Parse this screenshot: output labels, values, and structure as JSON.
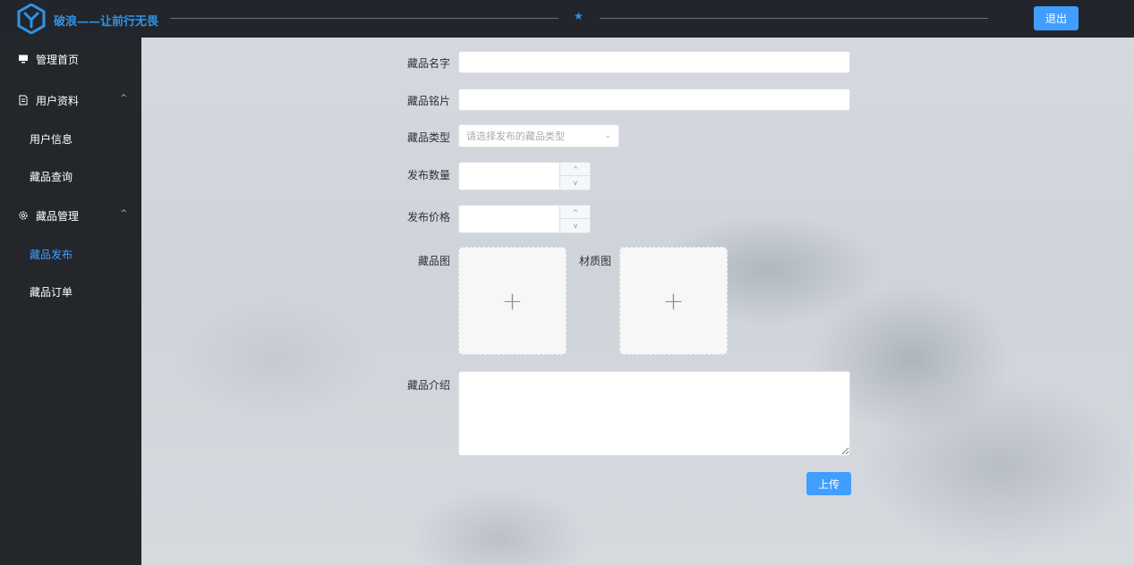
{
  "header": {
    "brand": "破浪——让前行无畏",
    "star": "★",
    "logout_label": "退出",
    "accent_color": "#409eff",
    "brand_color": "#2f94e8"
  },
  "sidebar": {
    "items": [
      {
        "label": "管理首页",
        "icon": "monitor-icon"
      },
      {
        "label": "用户资料",
        "icon": "document-icon",
        "expanded": true,
        "children": [
          {
            "label": "用户信息"
          },
          {
            "label": "藏品查询"
          }
        ]
      },
      {
        "label": "藏品管理",
        "icon": "gear-icon",
        "expanded": true,
        "children": [
          {
            "label": "藏品发布",
            "active": true
          },
          {
            "label": "藏品订单"
          }
        ]
      }
    ],
    "arrow": "^"
  },
  "form": {
    "name_label": "藏品名字",
    "name_value": "",
    "motto_label": "藏品铭片",
    "motto_value": "",
    "type_label": "藏品类型",
    "type_placeholder": "请选择发布的藏品类型",
    "quantity_label": "发布数量",
    "quantity_value": "",
    "price_label": "发布价格",
    "price_value": "",
    "image_label": "藏品图",
    "material_label": "材质图",
    "upload_plus": "+",
    "intro_label": "藏品介绍",
    "intro_value": "",
    "submit_label": "上传",
    "spin_up": "^",
    "spin_down": "v"
  }
}
